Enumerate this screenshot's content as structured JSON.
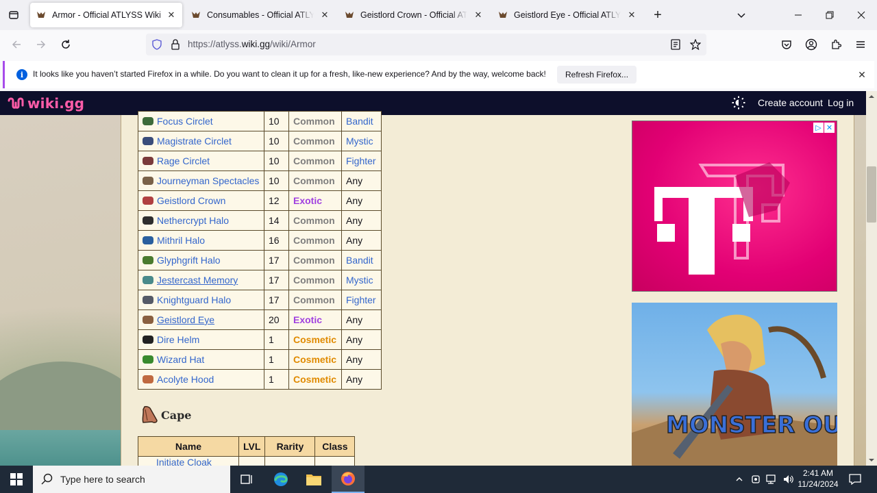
{
  "browser": {
    "tabs": [
      {
        "title": "Armor - Official ATLYSS Wiki",
        "active": true
      },
      {
        "title": "Consumables - Official ATLYSS Wiki",
        "active": false
      },
      {
        "title": "Geistlord Crown - Official ATLYSS Wiki",
        "active": false
      },
      {
        "title": "Geistlord Eye - Official ATLYSS Wiki",
        "active": false
      }
    ],
    "url_prefix": "https://atlyss.",
    "url_host": "wiki.gg",
    "url_path": "/wiki/Armor"
  },
  "notification": {
    "message": "It looks like you haven’t started Firefox in a while. Do you want to clean it up for a fresh, like-new experience? And by the way, welcome back!",
    "button": "Refresh Firefox..."
  },
  "wiki": {
    "logo_text": "wiki.gg",
    "create_account": "Create account",
    "login": "Log in"
  },
  "armor_rows": [
    {
      "name": "Focus Circlet",
      "lvl": "10",
      "rarity": "Common",
      "class": "Bandit",
      "class_link": true,
      "underline": false,
      "icon_color": "#3d6b3a"
    },
    {
      "name": "Magistrate Circlet",
      "lvl": "10",
      "rarity": "Common",
      "class": "Mystic",
      "class_link": true,
      "underline": false,
      "icon_color": "#3a4d7a"
    },
    {
      "name": "Rage Circlet",
      "lvl": "10",
      "rarity": "Common",
      "class": "Fighter",
      "class_link": true,
      "underline": false,
      "icon_color": "#7a3a3a"
    },
    {
      "name": "Journeyman Spectacles",
      "lvl": "10",
      "rarity": "Common",
      "class": "Any",
      "class_link": false,
      "underline": false,
      "icon_color": "#7a6248"
    },
    {
      "name": "Geistlord Crown",
      "lvl": "12",
      "rarity": "Exotic",
      "class": "Any",
      "class_link": false,
      "underline": false,
      "icon_color": "#b04040"
    },
    {
      "name": "Nethercrypt Halo",
      "lvl": "14",
      "rarity": "Common",
      "class": "Any",
      "class_link": false,
      "underline": false,
      "icon_color": "#2e2e2e"
    },
    {
      "name": "Mithril Halo",
      "lvl": "16",
      "rarity": "Common",
      "class": "Any",
      "class_link": false,
      "underline": false,
      "icon_color": "#2a5f9e"
    },
    {
      "name": "Glyphgrift Halo",
      "lvl": "17",
      "rarity": "Common",
      "class": "Bandit",
      "class_link": true,
      "underline": false,
      "icon_color": "#4a7a2e"
    },
    {
      "name": "Jestercast Memory",
      "lvl": "17",
      "rarity": "Common",
      "class": "Mystic",
      "class_link": true,
      "underline": true,
      "icon_color": "#4a8a8a"
    },
    {
      "name": "Knightguard Halo",
      "lvl": "17",
      "rarity": "Common",
      "class": "Fighter",
      "class_link": true,
      "underline": false,
      "icon_color": "#555a66"
    },
    {
      "name": "Geistlord Eye",
      "lvl": "20",
      "rarity": "Exotic",
      "class": "Any",
      "class_link": false,
      "underline": true,
      "icon_color": "#8a6040"
    },
    {
      "name": "Dire Helm",
      "lvl": "1",
      "rarity": "Cosmetic",
      "class": "Any",
      "class_link": false,
      "underline": false,
      "icon_color": "#222222"
    },
    {
      "name": "Wizard Hat",
      "lvl": "1",
      "rarity": "Cosmetic",
      "class": "Any",
      "class_link": false,
      "underline": false,
      "icon_color": "#3a8a2e"
    },
    {
      "name": "Acolyte Hood",
      "lvl": "1",
      "rarity": "Cosmetic",
      "class": "Any",
      "class_link": false,
      "underline": false,
      "icon_color": "#c06a40"
    }
  ],
  "cape_section": {
    "heading": "Cape",
    "headers": [
      "Name",
      "LVL",
      "Rarity",
      "Class"
    ],
    "first_row_name": "Initiate Cloak"
  },
  "ad2_text": "MONSTER OUTBREAK",
  "taskbar": {
    "search_placeholder": "Type here to search",
    "time": "2:41 AM",
    "date": "11/24/2024"
  },
  "colors": {
    "rarity_common": "#7d7d7d",
    "rarity_exotic": "#a040e0",
    "rarity_cosmetic": "#e08a00",
    "link": "#3366cc",
    "wiki_header_bg": "#0d0f2b",
    "wiki_logo": "#ff5ca8"
  }
}
